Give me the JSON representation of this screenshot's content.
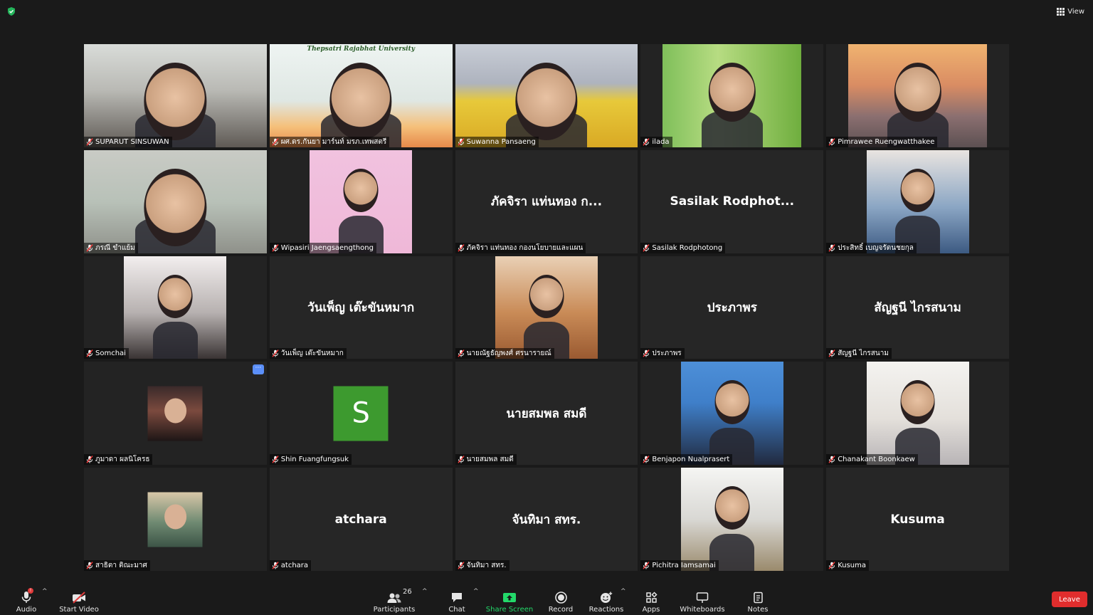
{
  "topbar": {
    "view_label": "View"
  },
  "tiles": [
    {
      "name": "SUPARUT SINSUWAN",
      "kind": "video",
      "bg": "bg-office"
    },
    {
      "name": "ผศ.ดร.กันยา มาร์นท์ มรภ.เทพสตรี",
      "kind": "video",
      "bg": "bg-univ",
      "active": true,
      "banner": "Thepsatri Rajabhat University"
    },
    {
      "name": "Suwanna Pansaeng",
      "kind": "video",
      "bg": "bg-flowers"
    },
    {
      "name": "ilada",
      "kind": "video",
      "bg": "bg-grass"
    },
    {
      "name": "Pimrawee Ruengwatthakee",
      "kind": "video",
      "bg": "bg-bridge"
    },
    {
      "name": "ภรณี ขำแย้ม",
      "kind": "video",
      "bg": "bg-room"
    },
    {
      "name": "Wipasiri Jaengsaengthong",
      "kind": "video",
      "bg": "bg-pink"
    },
    {
      "name": "ภัคจิรา แท่นทอง กองนโยบายและแผน",
      "kind": "name",
      "display": "ภัคจิรา แท่นทอง ก..."
    },
    {
      "name": "Sasilak Rodphotong",
      "kind": "name",
      "display": "Sasilak  Rodphot..."
    },
    {
      "name": "ประสิทธิ์ เบญจรัตนชยกุล",
      "kind": "video",
      "bg": "bg-denim"
    },
    {
      "name": "Somchai",
      "kind": "video",
      "bg": "bg-desk"
    },
    {
      "name": "วันเพ็ญ เต๊ะขันหมาก",
      "kind": "name",
      "display": "วันเพ็ญ เต๊ะขันหมาก"
    },
    {
      "name": "นายณัฐธัญพงศ์ ศรนารายณ์",
      "kind": "video",
      "bg": "bg-brown"
    },
    {
      "name": "ประภาพร",
      "kind": "name",
      "display": "ประภาพร"
    },
    {
      "name": "สัญฐนี  ไกรสนาม",
      "kind": "name",
      "display": "สัญฐนี  ไกรสนาม"
    },
    {
      "name": "ภูมาดา ผลนิโครธ",
      "kind": "avatar",
      "av": "av-red",
      "more": true
    },
    {
      "name": "Shin Fuangfungsuk",
      "kind": "letter",
      "letter": "S"
    },
    {
      "name": "นายสมพล  สมดี",
      "kind": "name",
      "display": "นายสมพล  สมดี"
    },
    {
      "name": "Benjapon Nualprasert",
      "kind": "video",
      "bg": "bg-blue"
    },
    {
      "name": "Chanakant Boonkaew",
      "kind": "video",
      "bg": "bg-white"
    },
    {
      "name": "สาธิตา ติณะมาศ",
      "kind": "avatar",
      "av": "av-green"
    },
    {
      "name": "atchara",
      "kind": "name",
      "display": "atchara"
    },
    {
      "name": "จันทิมา สทร.",
      "kind": "name",
      "display": "จันทิมา สทร."
    },
    {
      "name": "Pichitra Iamsamai",
      "kind": "video",
      "bg": "bg-hall"
    },
    {
      "name": "Kusuma",
      "kind": "name",
      "display": "Kusuma"
    }
  ],
  "more_label": "···",
  "toolbar": {
    "audio": "Audio",
    "audio_badge": "!",
    "start_video": "Start Video",
    "participants": "Participants",
    "participants_count": "26",
    "chat": "Chat",
    "share_screen": "Share Screen",
    "record": "Record",
    "reactions": "Reactions",
    "apps": "Apps",
    "whiteboards": "Whiteboards",
    "notes": "Notes",
    "leave": "Leave",
    "caret": "^"
  },
  "colors": {
    "active_border": "#c8e33a",
    "share_green": "#23d96a",
    "leave_red": "#e02d2d",
    "letter_avatar": "#3d9a2f"
  }
}
